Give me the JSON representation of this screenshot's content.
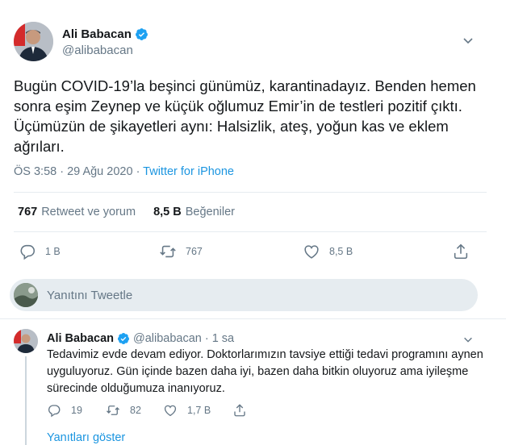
{
  "author": {
    "name": "Ali Babacan",
    "handle": "@alibabacan"
  },
  "tweet": {
    "text": "Bugün COVID-19’la beşinci günümüz, karantinadayız. Benden hemen sonra eşim Zeynep ve küçük oğlumuz Emir’in de testleri pozitif çıktı. Üçümüzün de şikayetleri aynı: Halsizlik, ateş, yoğun kas ve eklem ağrıları.",
    "time": "ÖS 3:58 · 29 Ağu 2020",
    "separator": "·",
    "source": "Twitter for iPhone"
  },
  "stats": {
    "retweets_count": "767",
    "retweets_label": "Retweet ve yorum",
    "likes_count": "8,5 B",
    "likes_label": "Beğeniler"
  },
  "actions": {
    "reply_count": "1 B",
    "retweet_count": "767",
    "like_count": "8,5 B"
  },
  "reply_box": {
    "placeholder": "Yanıtını Tweetle"
  },
  "reply": {
    "name": "Ali Babacan",
    "handle": "@alibabacan",
    "separator": "·",
    "time": "1 sa",
    "text": "Tedavimiz evde devam ediyor. Doktorlarımızın tavsiye ettiği tedavi programını aynen uyguluyoruz. Gün içinde bazen daha iyi, bazen daha bitkin oluyoruz ama iyileşme sürecinde olduğumuza inanıyoruz.",
    "reply_count": "19",
    "retweet_count": "82",
    "like_count": "1,7 B",
    "show_replies": "Yanıtları göster"
  },
  "colors": {
    "accent": "#1b95e0",
    "secondary_text": "#657786",
    "divider": "#e6ecf0"
  },
  "icons": [
    "verified-icon",
    "chevron-down-icon",
    "reply-icon",
    "retweet-icon",
    "like-icon",
    "share-icon"
  ]
}
